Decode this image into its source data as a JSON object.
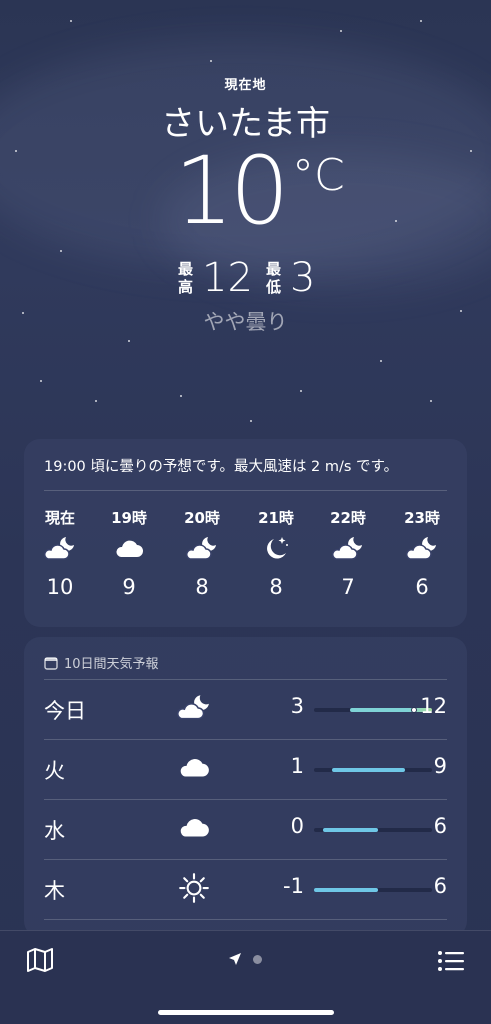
{
  "header": {
    "location_label": "現在地",
    "city": "さいたま市",
    "temperature": "10",
    "unit": "°C",
    "high_label": "最高",
    "high": "12",
    "low_label": "最低",
    "low": "3",
    "condition": "やや曇り"
  },
  "hourly": {
    "summary": "19:00 頃に曇りの予想です。最大風速は 2 m/s です。",
    "items": [
      {
        "time": "現在",
        "icon": "partly-cloudy-night-icon",
        "temp": "10"
      },
      {
        "time": "19時",
        "icon": "cloud-icon",
        "temp": "9"
      },
      {
        "time": "20時",
        "icon": "partly-cloudy-night-icon",
        "temp": "8"
      },
      {
        "time": "21時",
        "icon": "moon-stars-icon",
        "temp": "8"
      },
      {
        "time": "22時",
        "icon": "partly-cloudy-night-icon",
        "temp": "7"
      },
      {
        "time": "23時",
        "icon": "partly-cloudy-night-icon",
        "temp": "6"
      }
    ]
  },
  "daily": {
    "title": "10日間天気予報",
    "range_min": -1,
    "range_max": 12,
    "rows": [
      {
        "day": "今日",
        "icon": "partly-cloudy-night-icon",
        "low": "3",
        "high": "12",
        "current": 10,
        "lo_val": 3,
        "hi_val": 12
      },
      {
        "day": "火",
        "icon": "cloud-icon",
        "low": "1",
        "high": "9",
        "lo_val": 1,
        "hi_val": 9
      },
      {
        "day": "水",
        "icon": "cloud-icon",
        "low": "0",
        "high": "6",
        "lo_val": 0,
        "hi_val": 6
      },
      {
        "day": "木",
        "icon": "sun-icon",
        "low": "-1",
        "high": "6",
        "lo_val": -1,
        "hi_val": 6
      }
    ]
  },
  "colors": {
    "accent_bar": "#7fd3d6",
    "bar_start": "#6fc7e6",
    "bar_end": "#a6dca0"
  },
  "tabbar": {
    "map": "map-icon",
    "location": "location-arrow-icon",
    "list": "list-icon"
  }
}
